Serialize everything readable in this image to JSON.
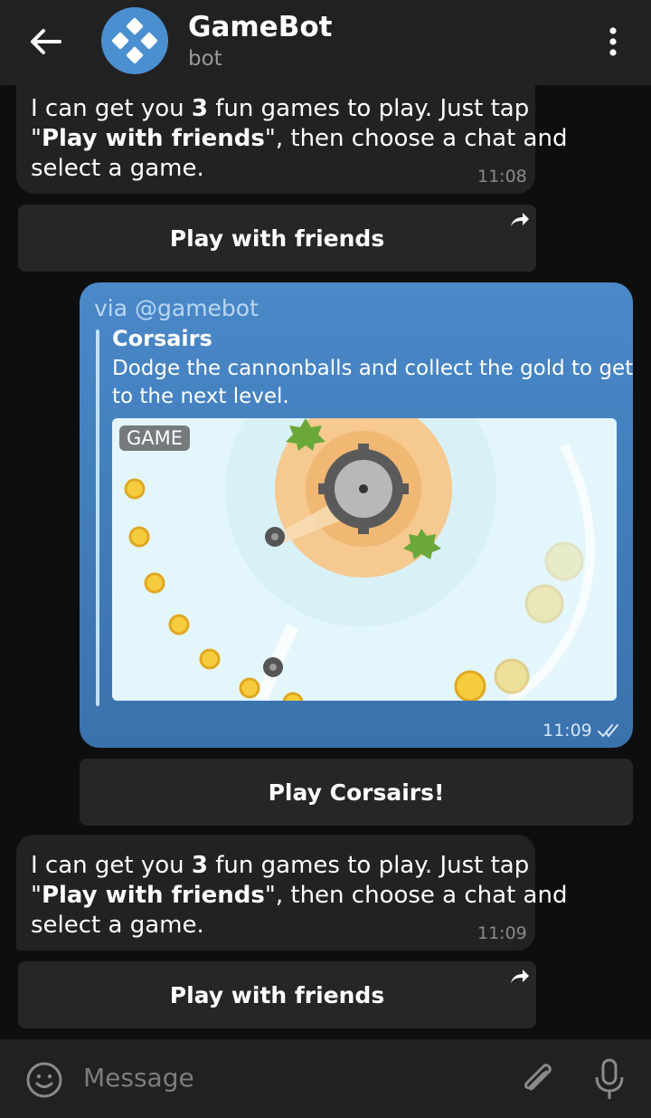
{
  "header": {
    "title": "GameBot",
    "subtitle": "bot"
  },
  "messages": [
    {
      "text_lines": [
        {
          "pre": "I can get you ",
          "bold": "3",
          "post": " fun games to play. Just tap"
        },
        {
          "pre": "\"",
          "bold": "Play with friends",
          "post": "\", then choose a chat and"
        },
        {
          "pre": "select a game.",
          "bold": "",
          "post": ""
        }
      ],
      "time": "11:08",
      "button_label": "Play with friends"
    },
    {
      "via": "via @gamebot",
      "game_title": "Corsairs",
      "game_description": "Dodge the cannonballs and collect the gold to get to the next level.",
      "badge": "GAME",
      "time": "11:09",
      "button_label": "Play Corsairs!"
    },
    {
      "text_lines": [
        {
          "pre": "I can get you ",
          "bold": "3",
          "post": " fun games to play. Just tap"
        },
        {
          "pre": "\"",
          "bold": "Play with friends",
          "post": "\", then choose a chat and"
        },
        {
          "pre": "select a game.",
          "bold": "",
          "post": ""
        }
      ],
      "time": "11:09",
      "button_label": "Play with friends"
    }
  ],
  "composer": {
    "placeholder": "Message"
  },
  "colors": {
    "header_bg": "#212121",
    "chat_bg": "#0e0e0e",
    "incoming_bubble": "#222222",
    "outgoing_bubble": "#4a88c8",
    "accent_avatar": "#4a8fcf"
  }
}
